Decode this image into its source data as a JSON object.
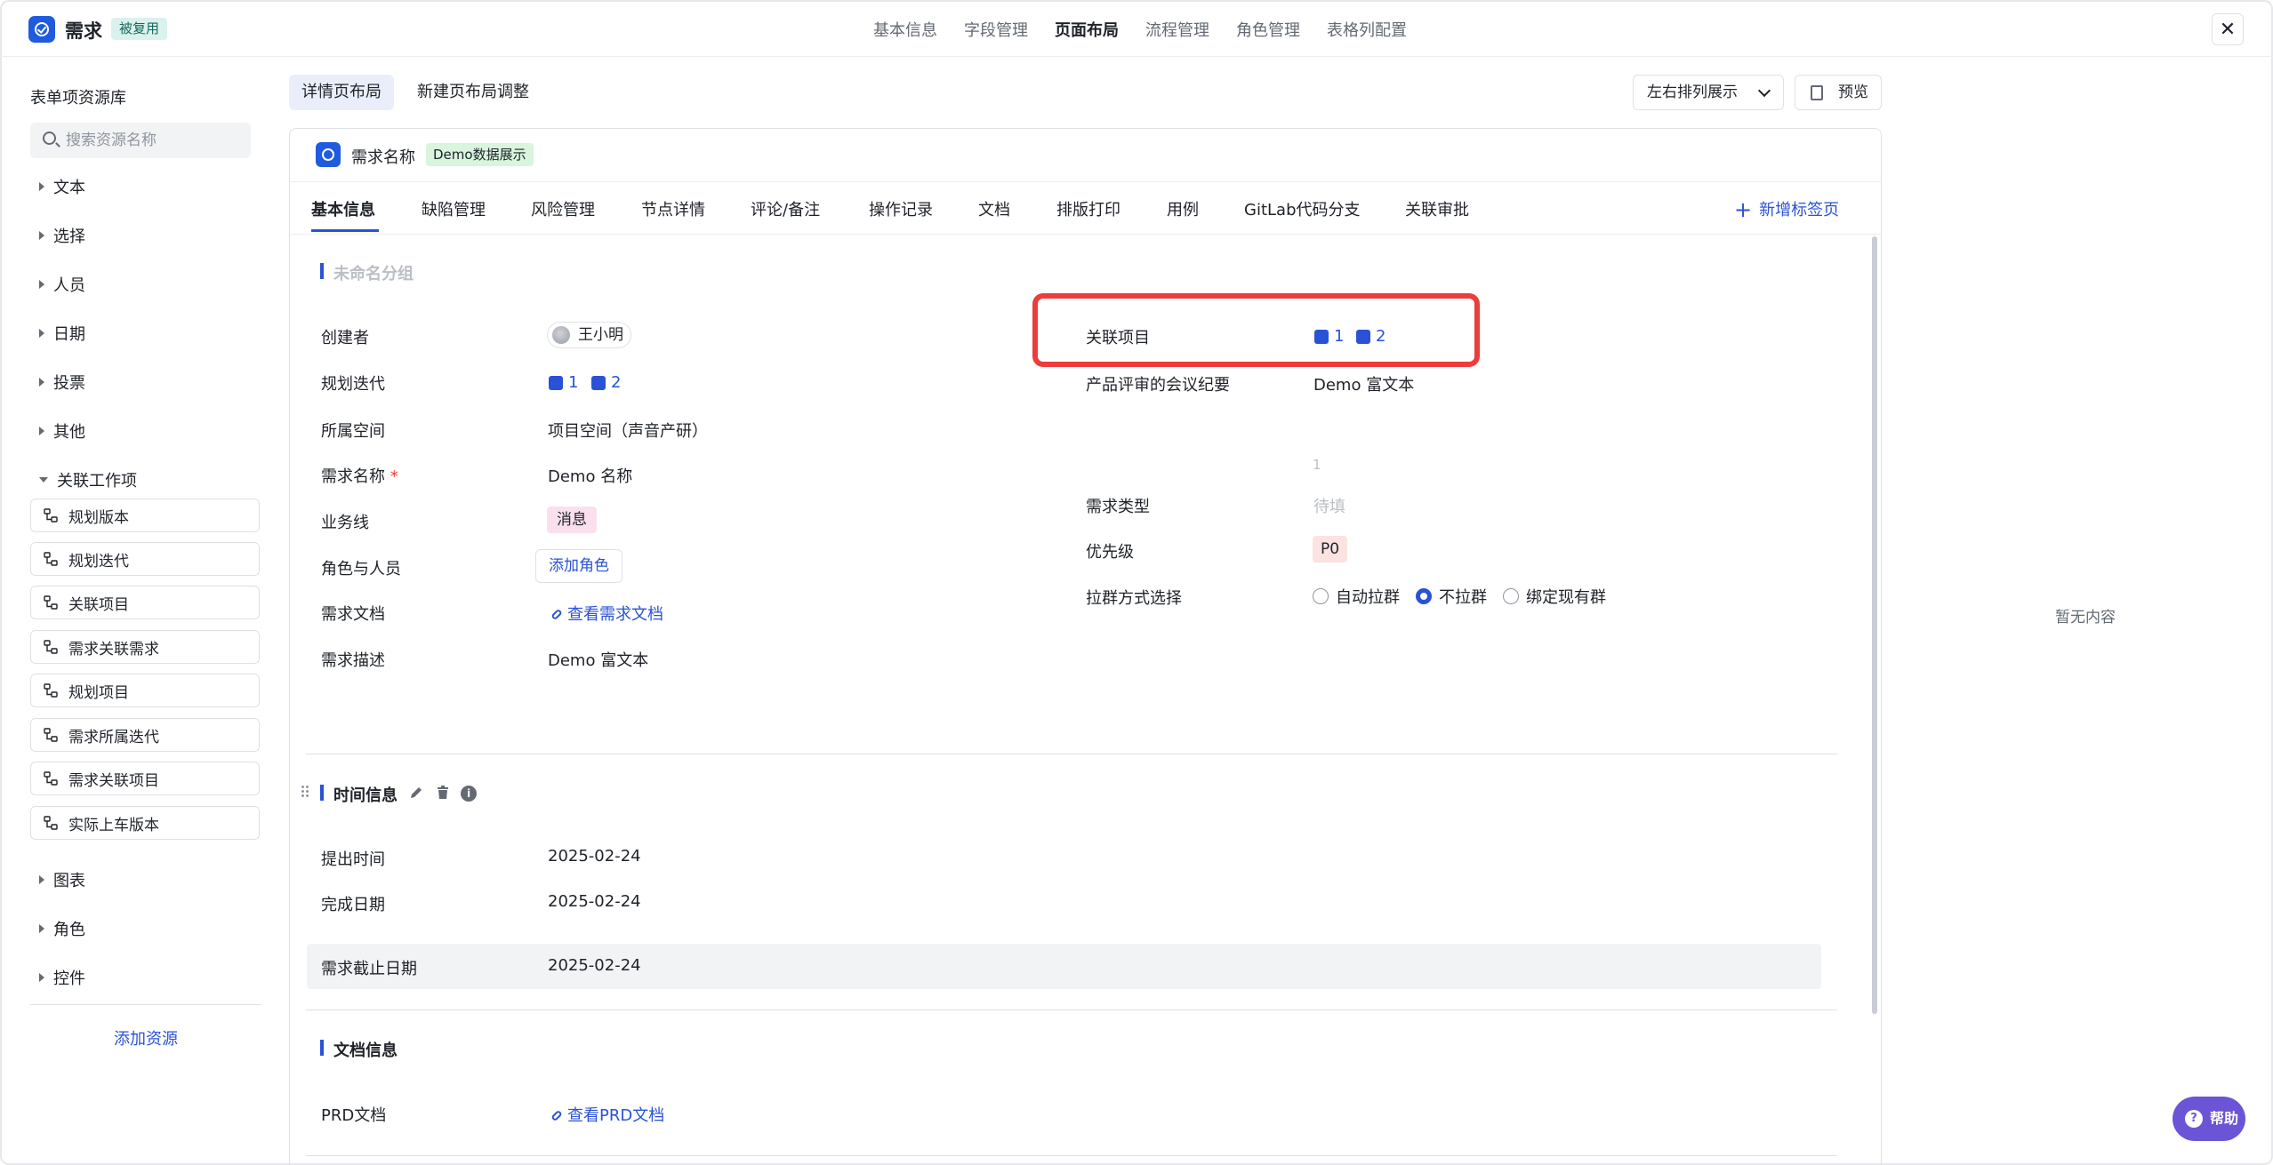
{
  "app": {
    "title": "需求",
    "reuse_badge": "被复用"
  },
  "top_nav": [
    "基本信息",
    "字段管理",
    "页面布局",
    "流程管理",
    "角色管理",
    "表格列配置"
  ],
  "sidebar": {
    "title": "表单项资源库",
    "search_placeholder": "搜索资源名称",
    "categories_top": [
      "文本",
      "选择",
      "人员",
      "日期",
      "投票",
      "其他"
    ],
    "expanded_category": "关联工作项",
    "items": [
      "规划版本",
      "规划迭代",
      "关联项目",
      "需求关联需求",
      "规划项目",
      "需求所属迭代",
      "需求关联项目",
      "实际上车版本"
    ],
    "categories_bottom": [
      "图表",
      "角色",
      "控件"
    ],
    "add_resource": "添加资源"
  },
  "header": {
    "tabs": [
      "详情页布局",
      "新建页布局调整"
    ],
    "sort_select": "左右排列展示",
    "preview": "预览"
  },
  "card": {
    "title": "需求名称",
    "badge": "Demo数据展示",
    "tabs": [
      "基本信息",
      "缺陷管理",
      "风险管理",
      "节点详情",
      "评论/备注",
      "操作记录",
      "文档",
      "排版打印",
      "用例",
      "GitLab代码分支",
      "关联审批"
    ],
    "new_tab": "新增标签页"
  },
  "group1": {
    "title": "未命名分组",
    "left": {
      "creator_label": "创建者",
      "creator_value": "王小明",
      "iteration_label": "规划迭代",
      "iteration_values": [
        "1",
        "2"
      ],
      "space_label": "所属空间",
      "space_value": "项目空间（声音产研）",
      "name_label": "需求名称",
      "required_mark": "*",
      "name_value": "Demo 名称",
      "line_label": "业务线",
      "line_value": "消息",
      "role_label": "角色与人员",
      "role_button": "添加角色",
      "doc_label": "需求文档",
      "doc_link": "查看需求文档",
      "desc_label": "需求描述",
      "desc_value": "Demo 富文本"
    },
    "right": {
      "project_label": "关联项目",
      "project_values": [
        "1",
        "2"
      ],
      "minutes_label": "产品评审的会议纪要",
      "minutes_value": "Demo 富文本",
      "stray_value": "1",
      "type_label": "需求类型",
      "type_value": "待填",
      "priority_label": "优先级",
      "priority_value": "P0",
      "group_label": "拉群方式选择",
      "group_options": [
        "自动拉群",
        "不拉群",
        "绑定现有群"
      ],
      "group_selected": "不拉群"
    }
  },
  "group2": {
    "title": "时间信息",
    "rows": [
      {
        "label": "提出时间",
        "value": "2025-02-24"
      },
      {
        "label": "完成日期",
        "value": "2025-02-24"
      },
      {
        "label": "需求截止日期",
        "value": "2025-02-24"
      }
    ]
  },
  "group3": {
    "title": "文档信息",
    "prd_label": "PRD文档",
    "prd_link": "查看PRD文档"
  },
  "right_panel": {
    "empty": "暂无内容"
  },
  "help": "帮助",
  "colors": {
    "accent": "#2a52d6",
    "highlight": "#ec3d3d",
    "help": "#6b54d6"
  }
}
